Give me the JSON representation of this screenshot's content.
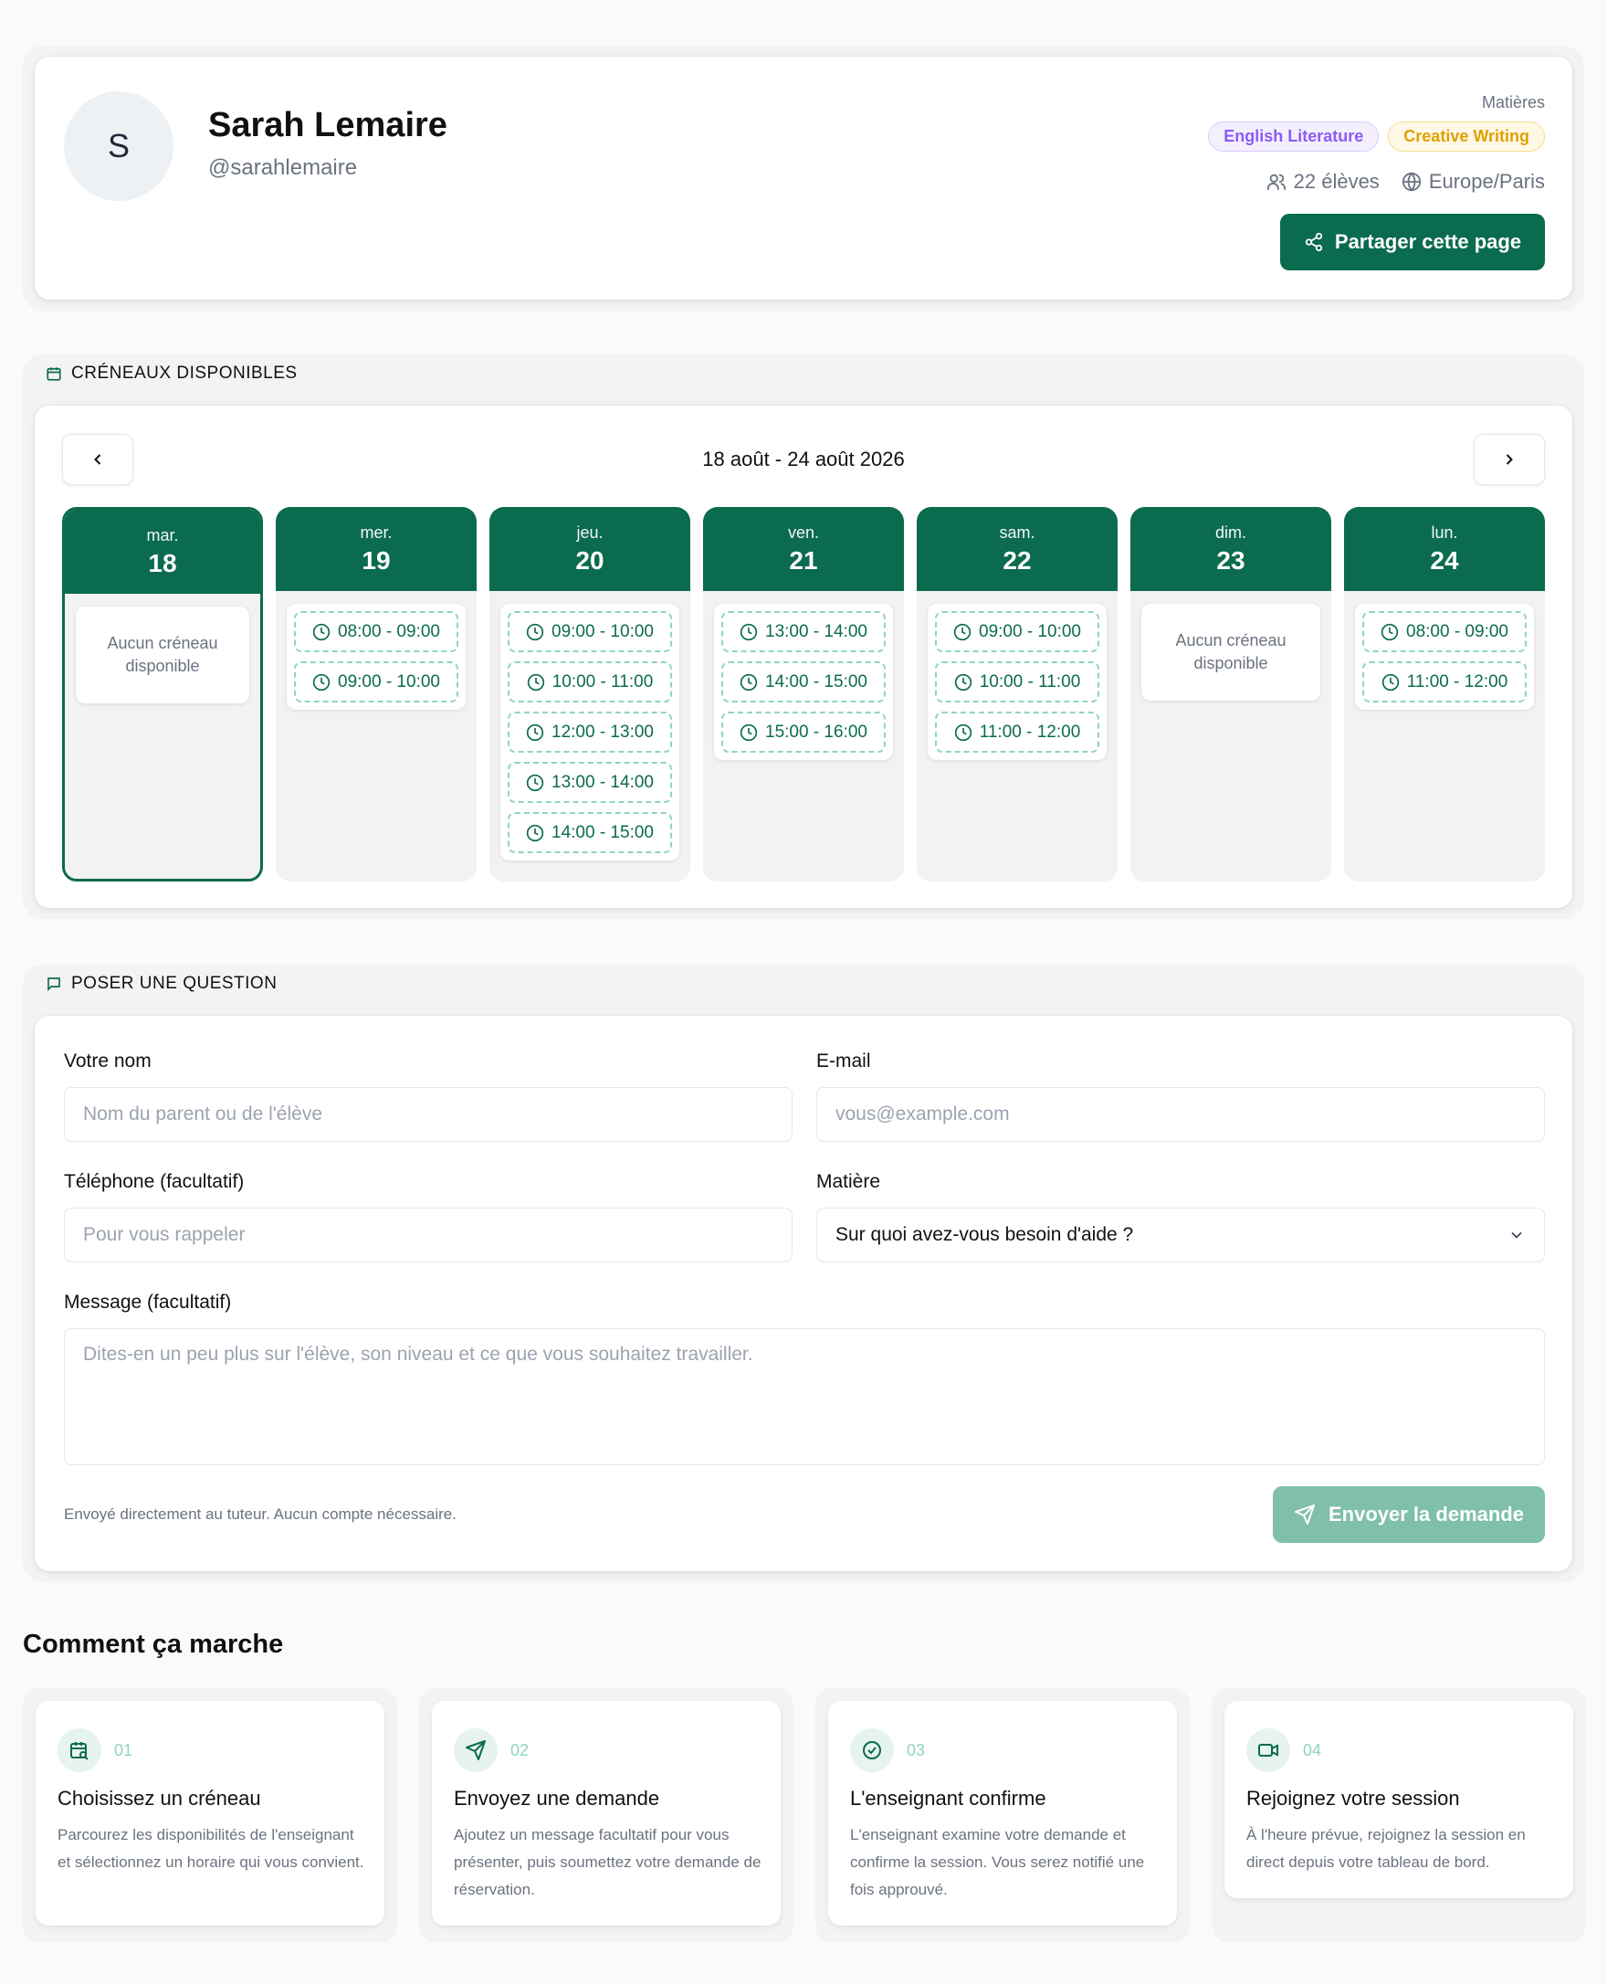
{
  "profile": {
    "avatar_initial": "S",
    "name": "Sarah Lemaire",
    "handle": "@sarahlemaire",
    "subjects_label": "Matières",
    "subjects": [
      "English Literature",
      "Creative Writing"
    ],
    "students": "22 élèves",
    "timezone": "Europe/Paris",
    "share_label": "Partager cette page"
  },
  "slots_section": {
    "title": "CRÉNEAUX DISPONIBLES",
    "range": "18 août - 24 août 2026",
    "no_slot": "Aucun créneau disponible",
    "days": [
      {
        "name": "mar.",
        "date": "18",
        "selected": true,
        "slots": []
      },
      {
        "name": "mer.",
        "date": "19",
        "slots": [
          "08:00 - 09:00",
          "09:00 - 10:00"
        ]
      },
      {
        "name": "jeu.",
        "date": "20",
        "slots": [
          "09:00 - 10:00",
          "10:00 - 11:00",
          "12:00 - 13:00",
          "13:00 - 14:00",
          "14:00 - 15:00"
        ]
      },
      {
        "name": "ven.",
        "date": "21",
        "slots": [
          "13:00 - 14:00",
          "14:00 - 15:00",
          "15:00 - 16:00"
        ]
      },
      {
        "name": "sam.",
        "date": "22",
        "slots": [
          "09:00 - 10:00",
          "10:00 - 11:00",
          "11:00 - 12:00"
        ]
      },
      {
        "name": "dim.",
        "date": "23",
        "slots": []
      },
      {
        "name": "lun.",
        "date": "24",
        "slots": [
          "08:00 - 09:00",
          "11:00 - 12:00"
        ]
      }
    ]
  },
  "question_section": {
    "title": "POSER UNE QUESTION",
    "name_label": "Votre nom",
    "name_placeholder": "Nom du parent ou de l'élève",
    "email_label": "E-mail",
    "email_placeholder": "vous@example.com",
    "phone_label": "Téléphone (facultatif)",
    "phone_placeholder": "Pour vous rappeler",
    "subject_label": "Matière",
    "subject_value": "Sur quoi avez-vous besoin d'aide ?",
    "message_label": "Message (facultatif)",
    "message_placeholder": "Dites-en un peu plus sur l'élève, son niveau et ce que vous souhaitez travailler.",
    "note": "Envoyé directement au tuteur. Aucun compte nécessaire.",
    "send_label": "Envoyer la demande"
  },
  "how": {
    "title": "Comment ça marche",
    "steps": [
      {
        "num": "01",
        "icon": "calendar-search-icon",
        "title": "Choisissez un créneau",
        "desc": "Parcourez les disponibilités de l'enseignant et sélectionnez un horaire qui vous convient."
      },
      {
        "num": "02",
        "icon": "send-icon",
        "title": "Envoyez une demande",
        "desc": "Ajoutez un message facultatif pour vous présenter, puis soumettez votre demande de réservation."
      },
      {
        "num": "03",
        "icon": "check-circle-icon",
        "title": "L'enseignant confirme",
        "desc": "L'enseignant examine votre demande et confirme la session. Vous serez notifié une fois approuvé."
      },
      {
        "num": "04",
        "icon": "video-icon",
        "title": "Rejoignez votre session",
        "desc": "À l'heure prévue, rejoignez la session en direct depuis votre tableau de bord."
      }
    ]
  },
  "colors": {
    "brand": "#0b6b4f",
    "brand_light": "#7fbfab",
    "slot_border": "#8fd6b9"
  }
}
